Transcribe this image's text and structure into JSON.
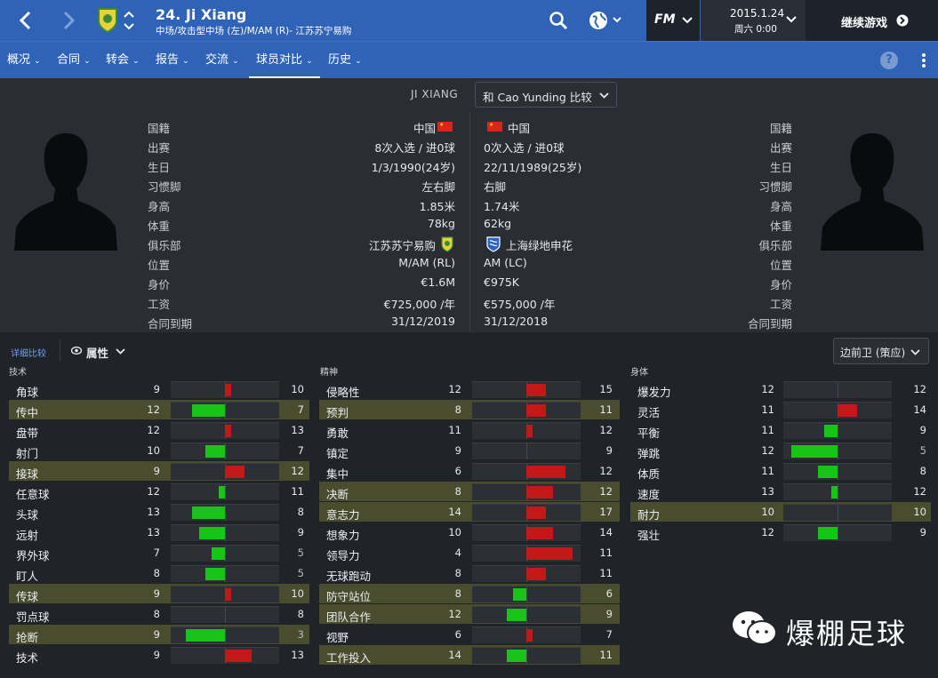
{
  "header": {
    "title": "24. Ji Xiang",
    "subtitle": "中场/攻击型中场 (左)/M/AM (R)- 江苏苏宁易购",
    "date": "2015.1.24",
    "time": "周六 0:00",
    "continue_label": "继续游戏",
    "fm_label": "FM"
  },
  "nav": {
    "items": [
      "概况",
      "合同",
      "转会",
      "报告",
      "交流",
      "球员对比",
      "历史"
    ],
    "active": "球员对比",
    "help": "?"
  },
  "compare": {
    "player_name": "JI XIANG",
    "select_label": "和 Cao Yunding 比较"
  },
  "info": {
    "labels": [
      "国籍",
      "出赛",
      "生日",
      "习惯脚",
      "身高",
      "体重",
      "俱乐部",
      "位置",
      "身价",
      "工资",
      "合同到期"
    ],
    "left": [
      "中国",
      "8次入选 / 进0球",
      "1/3/1990(24岁)",
      "左右脚",
      "1.85米",
      "78kg",
      "江苏苏宁易购",
      "M/AM (RL)",
      "€1.6M",
      "€725,000 /年",
      "31/12/2019"
    ],
    "right": [
      "中国",
      "0次入选 / 进0球",
      "22/11/1989(25岁)",
      "右脚",
      "1.74米",
      "62kg",
      "上海绿地申花",
      "AM (LC)",
      "€975K",
      "€575,000 /年",
      "31/12/2018"
    ]
  },
  "controls": {
    "detail_label": "详细比较",
    "attr_label": "属性",
    "role_label": "边前卫 (策应)"
  },
  "sections": [
    {
      "title": "技术",
      "rows": [
        {
          "name": "角球",
          "a": 9,
          "b": 10,
          "hl": false
        },
        {
          "name": "传中",
          "a": 12,
          "b": 7,
          "hl": true
        },
        {
          "name": "盘带",
          "a": 12,
          "b": 13,
          "hl": false
        },
        {
          "name": "射门",
          "a": 10,
          "b": 7,
          "hl": false
        },
        {
          "name": "接球",
          "a": 9,
          "b": 12,
          "hl": true
        },
        {
          "name": "任意球",
          "a": 12,
          "b": 11,
          "hl": false
        },
        {
          "name": "头球",
          "a": 13,
          "b": 8,
          "hl": false
        },
        {
          "name": "远射",
          "a": 13,
          "b": 9,
          "hl": false
        },
        {
          "name": "界外球",
          "a": 7,
          "b": 5,
          "hl": false
        },
        {
          "name": "盯人",
          "a": 8,
          "b": 5,
          "hl": false
        },
        {
          "name": "传球",
          "a": 9,
          "b": 10,
          "hl": true
        },
        {
          "name": "罚点球",
          "a": 8,
          "b": 8,
          "hl": false
        },
        {
          "name": "抢断",
          "a": 9,
          "b": 3,
          "hl": true
        },
        {
          "name": "技术",
          "a": 9,
          "b": 13,
          "hl": false
        }
      ]
    },
    {
      "title": "精神",
      "rows": [
        {
          "name": "侵略性",
          "a": 12,
          "b": 15,
          "hl": false
        },
        {
          "name": "预判",
          "a": 8,
          "b": 11,
          "hl": true
        },
        {
          "name": "勇敢",
          "a": 11,
          "b": 12,
          "hl": false
        },
        {
          "name": "镇定",
          "a": 9,
          "b": 9,
          "hl": false
        },
        {
          "name": "集中",
          "a": 6,
          "b": 12,
          "hl": false
        },
        {
          "name": "决断",
          "a": 8,
          "b": 12,
          "hl": true
        },
        {
          "name": "意志力",
          "a": 14,
          "b": 17,
          "hl": true
        },
        {
          "name": "想象力",
          "a": 10,
          "b": 14,
          "hl": false
        },
        {
          "name": "领导力",
          "a": 4,
          "b": 11,
          "hl": false
        },
        {
          "name": "无球跑动",
          "a": 8,
          "b": 11,
          "hl": false
        },
        {
          "name": "防守站位",
          "a": 8,
          "b": 6,
          "hl": true
        },
        {
          "name": "团队合作",
          "a": 12,
          "b": 9,
          "hl": true
        },
        {
          "name": "视野",
          "a": 6,
          "b": 7,
          "hl": false
        },
        {
          "name": "工作投入",
          "a": 14,
          "b": 11,
          "hl": true
        }
      ]
    },
    {
      "title": "身体",
      "rows": [
        {
          "name": "爆发力",
          "a": 12,
          "b": 12,
          "hl": false
        },
        {
          "name": "灵活",
          "a": 11,
          "b": 14,
          "hl": false
        },
        {
          "name": "平衡",
          "a": 11,
          "b": 9,
          "hl": false
        },
        {
          "name": "弹跳",
          "a": 12,
          "b": 5,
          "hl": false
        },
        {
          "name": "体质",
          "a": 11,
          "b": 8,
          "hl": false
        },
        {
          "name": "速度",
          "a": 13,
          "b": 12,
          "hl": false
        },
        {
          "name": "耐力",
          "a": 10,
          "b": 10,
          "hl": true
        },
        {
          "name": "强壮",
          "a": 12,
          "b": 9,
          "hl": false
        }
      ]
    }
  ],
  "watermark": "爆棚足球",
  "colors": {
    "primary": "#2f63b8",
    "better": "#18c418",
    "worse": "#c41818",
    "highlight": "#4a4c2e"
  }
}
